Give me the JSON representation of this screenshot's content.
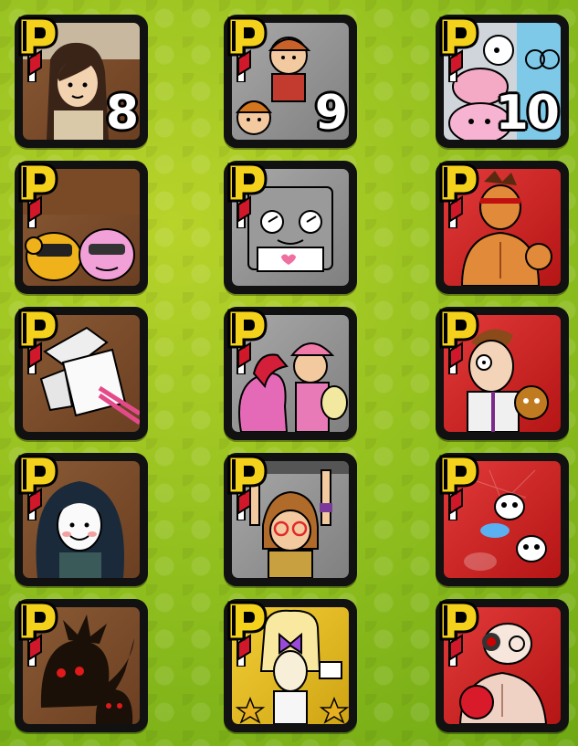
{
  "badge": {
    "letter": "P"
  },
  "tiles": [
    {
      "number": "8",
      "character_icon": "long-haired-girl-icon"
    },
    {
      "number": "9",
      "character_icon": "kids-group-icon"
    },
    {
      "number": "10",
      "character_icon": "pink-creatures-icon"
    },
    {
      "number": "",
      "character_icon": "monkey-and-pink-creature-icon"
    },
    {
      "number": "",
      "character_icon": "robot-face-icon"
    },
    {
      "number": "",
      "character_icon": "muscle-fighter-icon"
    },
    {
      "number": "",
      "character_icon": "paper-napkin-icon"
    },
    {
      "number": "",
      "character_icon": "pink-dragon-and-girl-icon"
    },
    {
      "number": "",
      "character_icon": "scientist-with-monkey-icon"
    },
    {
      "number": "",
      "character_icon": "long-haired-ghost-girl-icon"
    },
    {
      "number": "",
      "character_icon": "glasses-girl-hanging-icon"
    },
    {
      "number": "",
      "character_icon": "ghosts-icon"
    },
    {
      "number": "",
      "character_icon": "shadow-monsters-icon"
    },
    {
      "number": "",
      "character_icon": "butterfly-idol-icon"
    },
    {
      "number": "",
      "character_icon": "boxer-icon"
    }
  ],
  "colors": {
    "background": "#9cc41f",
    "frame": "#111111",
    "badge_yellow": "#f4d21c",
    "badge_red": "#d0182a"
  }
}
